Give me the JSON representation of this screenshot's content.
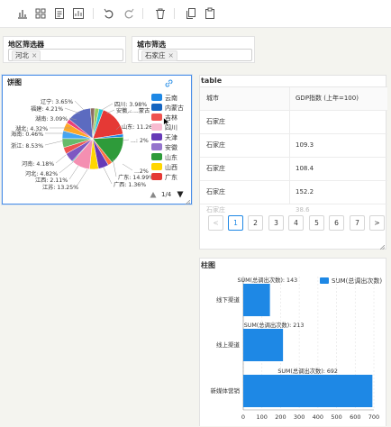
{
  "toolbar": {
    "icons": [
      "bar-chart-icon",
      "grid-table-icon",
      "form-icon",
      "embed-chart-icon",
      "undo-icon",
      "redo-icon",
      "delete-icon",
      "copy-icon",
      "paste-icon"
    ]
  },
  "region_filter": {
    "title": "地区筛选器",
    "value": "河北"
  },
  "city_filter": {
    "title": "城市筛选",
    "value": "石家庄"
  },
  "pie_panel": {
    "title": "饼图",
    "pager": "1/4",
    "labels": [
      "辽宁: 3.65%",
      "福建: 4.21%",
      "湖南: 3.09%",
      "湖北: 4.32%",
      "海南: 0.46%",
      "浙江: 8.53%",
      "河南: 4.18%",
      "河北: 4.82%",
      "江西: 2.11%",
      "江苏: 13.25%",
      "四川: 3.98%",
      "安徽...",
      "山东: 11.26%",
      "广东: 14.99%",
      "广西: 1.36%",
      "...: 2%",
      "...蒙古",
      "...2%"
    ],
    "legend": [
      {
        "name": "云南",
        "color": "#1e88e5"
      },
      {
        "name": "内蒙古",
        "color": "#1565c0"
      },
      {
        "name": "吉林",
        "color": "#ef5350"
      },
      {
        "name": "四川",
        "color": "#f8bbd0"
      },
      {
        "name": "天津",
        "color": "#673ab7"
      },
      {
        "name": "安徽",
        "color": "#9575cd"
      },
      {
        "name": "山东",
        "color": "#2e9b3a"
      },
      {
        "name": "山西",
        "color": "#ffd600"
      },
      {
        "name": "广东",
        "color": "#e53935"
      }
    ]
  },
  "table_panel": {
    "title": "table",
    "headers": [
      "城市",
      "GDP指数 (上年=100)"
    ],
    "rows": [
      [
        "石家庄",
        ""
      ],
      [
        "石家庄",
        "109.3"
      ],
      [
        "石家庄",
        "108.4"
      ],
      [
        "石家庄",
        "152.2"
      ],
      [
        "石家庄",
        "38.6"
      ]
    ],
    "pages": [
      "1",
      "2",
      "3",
      "4",
      "5",
      "6",
      "7"
    ],
    "active_page": "1",
    "prev": "<",
    "next": ">"
  },
  "bar_panel": {
    "title": "柱图",
    "legend": "SUM(总调出次数)"
  },
  "chart_data": {
    "type": "bar",
    "orientation": "horizontal",
    "categories": [
      "线下渠道",
      "线上渠道",
      "新媒体营销"
    ],
    "series": [
      {
        "name": "SUM(总调出次数)",
        "values": [
          143,
          213,
          692
        ]
      }
    ],
    "data_labels": [
      "SUM(总调出次数): 143",
      "SUM(总调出次数): 213",
      "SUM(总调出次数): 692"
    ],
    "x_ticks": [
      "0",
      "100",
      "200",
      "300",
      "400",
      "500",
      "600",
      "700"
    ],
    "xlim": [
      0,
      700
    ],
    "colors": {
      "bar": "#1e88e5"
    }
  },
  "colors": {
    "accent": "#1e88e5",
    "pie": [
      "#e53935",
      "#1e88e5",
      "#2e9b3a",
      "#ff7043",
      "#673ab7",
      "#ffd600",
      "#f48fb1",
      "#26a69a",
      "#7e57c2",
      "#ef5350",
      "#66bb6a",
      "#42a5f5",
      "#ffa726",
      "#ec407a",
      "#5c6bc0",
      "#8d6e63",
      "#9ccc65",
      "#26c6da"
    ]
  }
}
